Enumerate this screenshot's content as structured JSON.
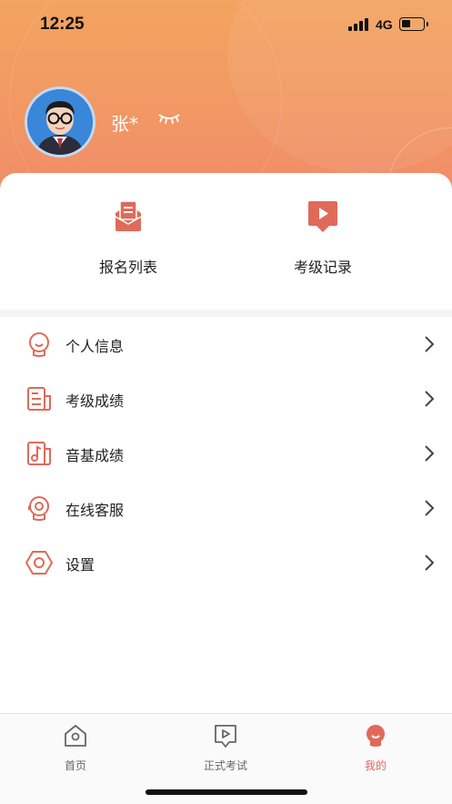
{
  "status_bar": {
    "time": "12:25",
    "network": "4G"
  },
  "profile": {
    "username": "张*",
    "avatar_icon": "student-avatar",
    "visibility_icon": "eye-closed-icon"
  },
  "quick_actions": [
    {
      "label": "报名列表",
      "icon": "registration-list-icon"
    },
    {
      "label": "考级记录",
      "icon": "exam-record-icon"
    }
  ],
  "menu": [
    {
      "label": "个人信息",
      "icon": "personal-info-icon"
    },
    {
      "label": "考级成绩",
      "icon": "exam-score-icon"
    },
    {
      "label": "音基成绩",
      "icon": "music-theory-score-icon"
    },
    {
      "label": "在线客服",
      "icon": "customer-service-icon"
    },
    {
      "label": "设置",
      "icon": "settings-icon"
    }
  ],
  "tabbar": [
    {
      "label": "首页",
      "icon": "home-icon",
      "active": false
    },
    {
      "label": "正式考试",
      "icon": "formal-exam-icon",
      "active": false
    },
    {
      "label": "我的",
      "icon": "profile-icon",
      "active": true
    }
  ],
  "colors": {
    "accent": "#e06a5a",
    "header_gradient_top": "#f3a460",
    "header_gradient_bottom": "#f08a6a"
  }
}
